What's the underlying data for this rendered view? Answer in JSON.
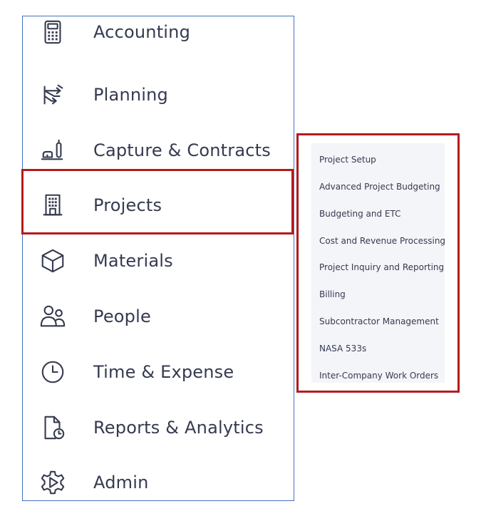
{
  "sidebar": {
    "items": [
      {
        "label": "Accounting",
        "icon": "calculator-icon"
      },
      {
        "label": "Planning",
        "icon": "planning-arrows-icon"
      },
      {
        "label": "Capture & Contracts",
        "icon": "capture-contracts-icon"
      },
      {
        "label": "Projects",
        "icon": "building-icon",
        "selected": true
      },
      {
        "label": "Materials",
        "icon": "cube-icon"
      },
      {
        "label": "People",
        "icon": "people-icon"
      },
      {
        "label": "Time & Expense",
        "icon": "clock-icon"
      },
      {
        "label": "Reports & Analytics",
        "icon": "report-clock-icon"
      },
      {
        "label": "Admin",
        "icon": "gear-icon"
      }
    ]
  },
  "submenu": {
    "items": [
      "Project Setup",
      "Advanced Project Budgeting",
      "Budgeting and ETC",
      "Cost and Revenue Processing",
      "Project Inquiry and Reporting",
      "Billing",
      "Subcontractor Management",
      "NASA 533s",
      "Inter-Company Work Orders"
    ]
  },
  "colors": {
    "sidebar_border": "#4472c4",
    "highlight": "#b31b1b",
    "text": "#353a4f",
    "submenu_bg": "#f4f5f9"
  }
}
